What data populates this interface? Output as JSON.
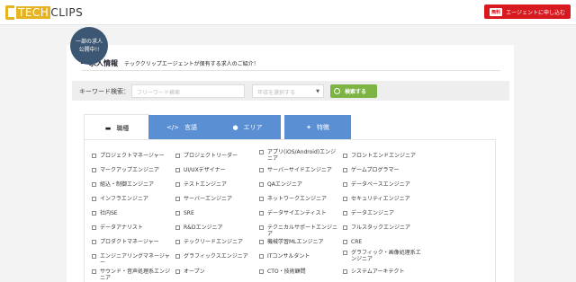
{
  "header": {
    "logo_tech": "TECH",
    "logo_clips": "CLIPS",
    "cta_free": "無料",
    "cta_label": "エージェントに申し込む"
  },
  "badge": {
    "line1": "一部の求人",
    "line2": "公開中!!"
  },
  "section": {
    "title": "求人情報",
    "subtitle": "テッククリップエージェントが保有する求人のご紹介！"
  },
  "search": {
    "label": "キーワード検索：",
    "keyword_placeholder": "フリーワード検索",
    "year_placeholder": "年収を選択する",
    "button_label": "検索する"
  },
  "tabs": [
    {
      "label": "職種",
      "icon": "monitor-icon"
    },
    {
      "label": "言語",
      "icon": "code-icon"
    },
    {
      "label": "エリア",
      "icon": "location-pin-icon"
    },
    {
      "label": "特徴",
      "icon": "sparkle-icon"
    }
  ],
  "job_types": [
    [
      "プロジェクトマネージャー",
      "プロジェクトリーダー",
      "アプリ(iOS/Android)エンジニア",
      "フロントエンドエンジニア"
    ],
    [
      "マークアップエンジニア",
      "UI/UXデザイナー",
      "サーバーサイドエンジニア",
      "ゲームプログラマー"
    ],
    [
      "組込・制御エンジニア",
      "テストエンジニア",
      "QAエンジニア",
      "データベースエンジニア"
    ],
    [
      "インフラエンジニア",
      "サーバーエンジニア",
      "ネットワークエンジニア",
      "セキュリティエンジニア"
    ],
    [
      "社内SE",
      "SRE",
      "データサイエンティスト",
      "データエンジニア"
    ],
    [
      "データアナリスト",
      "R&Dエンジニア",
      "テクニカルサポートエンジニア",
      "フルスタックエンジニア"
    ],
    [
      "プロダクトマネージャー",
      "テックリードエンジニア",
      "機械学習MLエンジニア",
      "CRE"
    ],
    [
      "エンジニアリングマネージャー",
      "グラフィックスエンジニア",
      "ITコンサルタント",
      "グラフィック・画像処理系エンジニア"
    ],
    [
      "サウンド・音声処理系エンジニア",
      "オープン",
      "CTO・技術顧問",
      "システムアーキテクト"
    ]
  ],
  "colors": {
    "accent_gold": "#e6b422",
    "cta_red": "#d71920",
    "tab_blue": "#5b8fd4",
    "search_green": "#7cb342",
    "badge_navy": "#3b5773"
  }
}
